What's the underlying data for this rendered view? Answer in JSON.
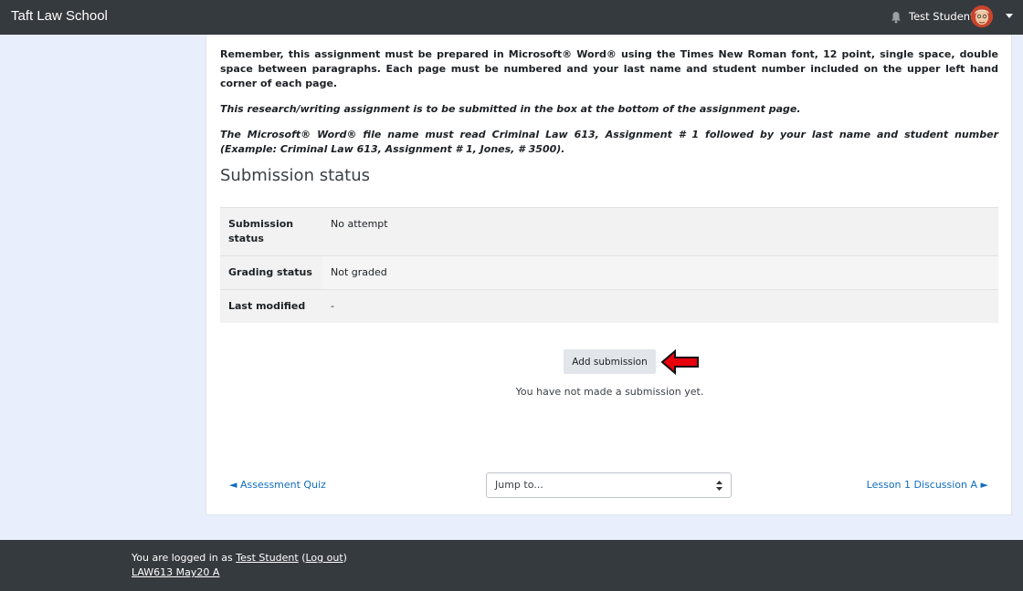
{
  "navbar": {
    "brand": "Taft Law School",
    "user_name": "Test Student",
    "icons": {
      "bell": "bell-icon",
      "caret": "chevron-down-icon"
    }
  },
  "instructions": {
    "p1": "Remember, this assignment must be prepared in Microsoft® Word® using the Times New Roman font, 12 point, single space, double space between paragraphs. Each page must be numbered and your last name and student number included on the upper left hand corner of each page.",
    "p2": "This research/writing assignment is to be submitted in the box at the bottom of the assignment page.",
    "p3": "The Microsoft® Word® file name must read Criminal Law 613, Assignment # 1 followed by your last name and student number (Example: Criminal Law 613, Assignment # 1, Jones, # 3500)."
  },
  "submission": {
    "title": "Submission status",
    "rows": [
      {
        "label": "Submission status",
        "value": "No attempt"
      },
      {
        "label": "Grading status",
        "value": "Not graded"
      },
      {
        "label": "Last modified",
        "value": "-"
      }
    ],
    "add_button": "Add submission",
    "no_submission_text": "You have not made a submission yet."
  },
  "navigation": {
    "prev": "◄ Assessment Quiz",
    "next": "Lesson 1 Discussion A ►",
    "jump": "Jump to..."
  },
  "footer": {
    "logged_in_prefix": "You are logged in as ",
    "user_link": "Test Student",
    "logout_open": " (",
    "logout_link": "Log out",
    "logout_close": ")",
    "course_link": "LAW613 May20 A"
  },
  "colors": {
    "navbar": "#353a3f",
    "page_bg": "#e9eefc",
    "link": "#0f6cbf",
    "arrow": "#e8000b"
  }
}
